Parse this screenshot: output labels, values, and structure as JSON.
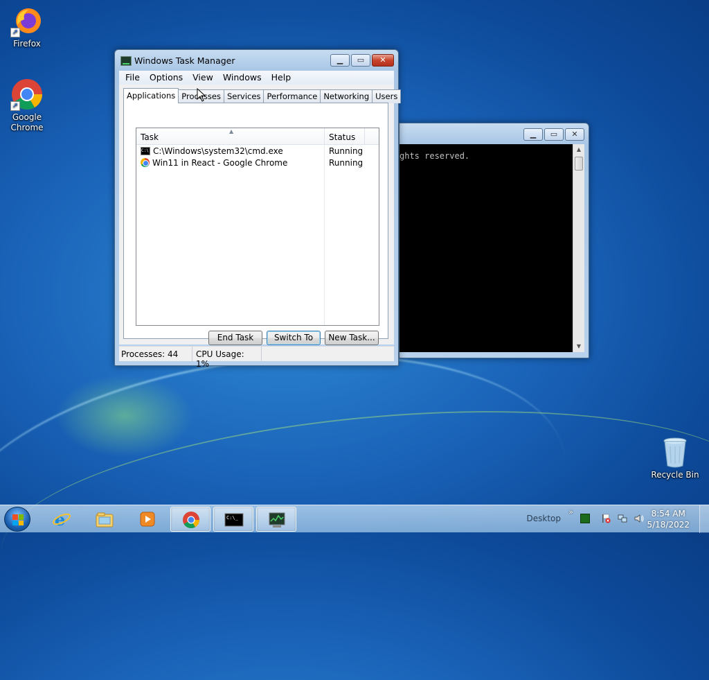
{
  "desktop": {
    "icons": [
      {
        "label": "Firefox"
      },
      {
        "label": "Google Chrome"
      },
      {
        "label": "Recycle Bin"
      }
    ]
  },
  "taskmgr": {
    "title": "Windows Task Manager",
    "menu": [
      "File",
      "Options",
      "View",
      "Windows",
      "Help"
    ],
    "tabs": [
      "Applications",
      "Processes",
      "Services",
      "Performance",
      "Networking",
      "Users"
    ],
    "active_tab": "Applications",
    "columns": {
      "task": "Task",
      "status": "Status"
    },
    "rows": [
      {
        "task": "C:\\Windows\\system32\\cmd.exe",
        "status": "Running",
        "icon": "cmd-icon"
      },
      {
        "task": "Win11 in React - Google Chrome",
        "status": "Running",
        "icon": "chrome-icon"
      }
    ],
    "buttons": {
      "end_task": "End Task",
      "switch_to": "Switch To",
      "new_task": "New Task..."
    },
    "status": {
      "processes": "Processes: 44",
      "cpu": "CPU Usage: 1%"
    }
  },
  "cmd": {
    "visible_text": "ghts reserved."
  },
  "taskbar": {
    "desktop_label": "Desktop",
    "time": "8:54 AM",
    "date": "5/18/2022",
    "pinned": [
      "start-orb",
      "internet-explorer-icon",
      "file-explorer-icon",
      "media-player-icon",
      "chrome-icon",
      "cmd-icon",
      "task-manager-icon"
    ]
  },
  "colors": {
    "desktop_bg": "#1a63b8",
    "close_button": "#c9442c",
    "default_button_border": "#3c7fb1"
  }
}
